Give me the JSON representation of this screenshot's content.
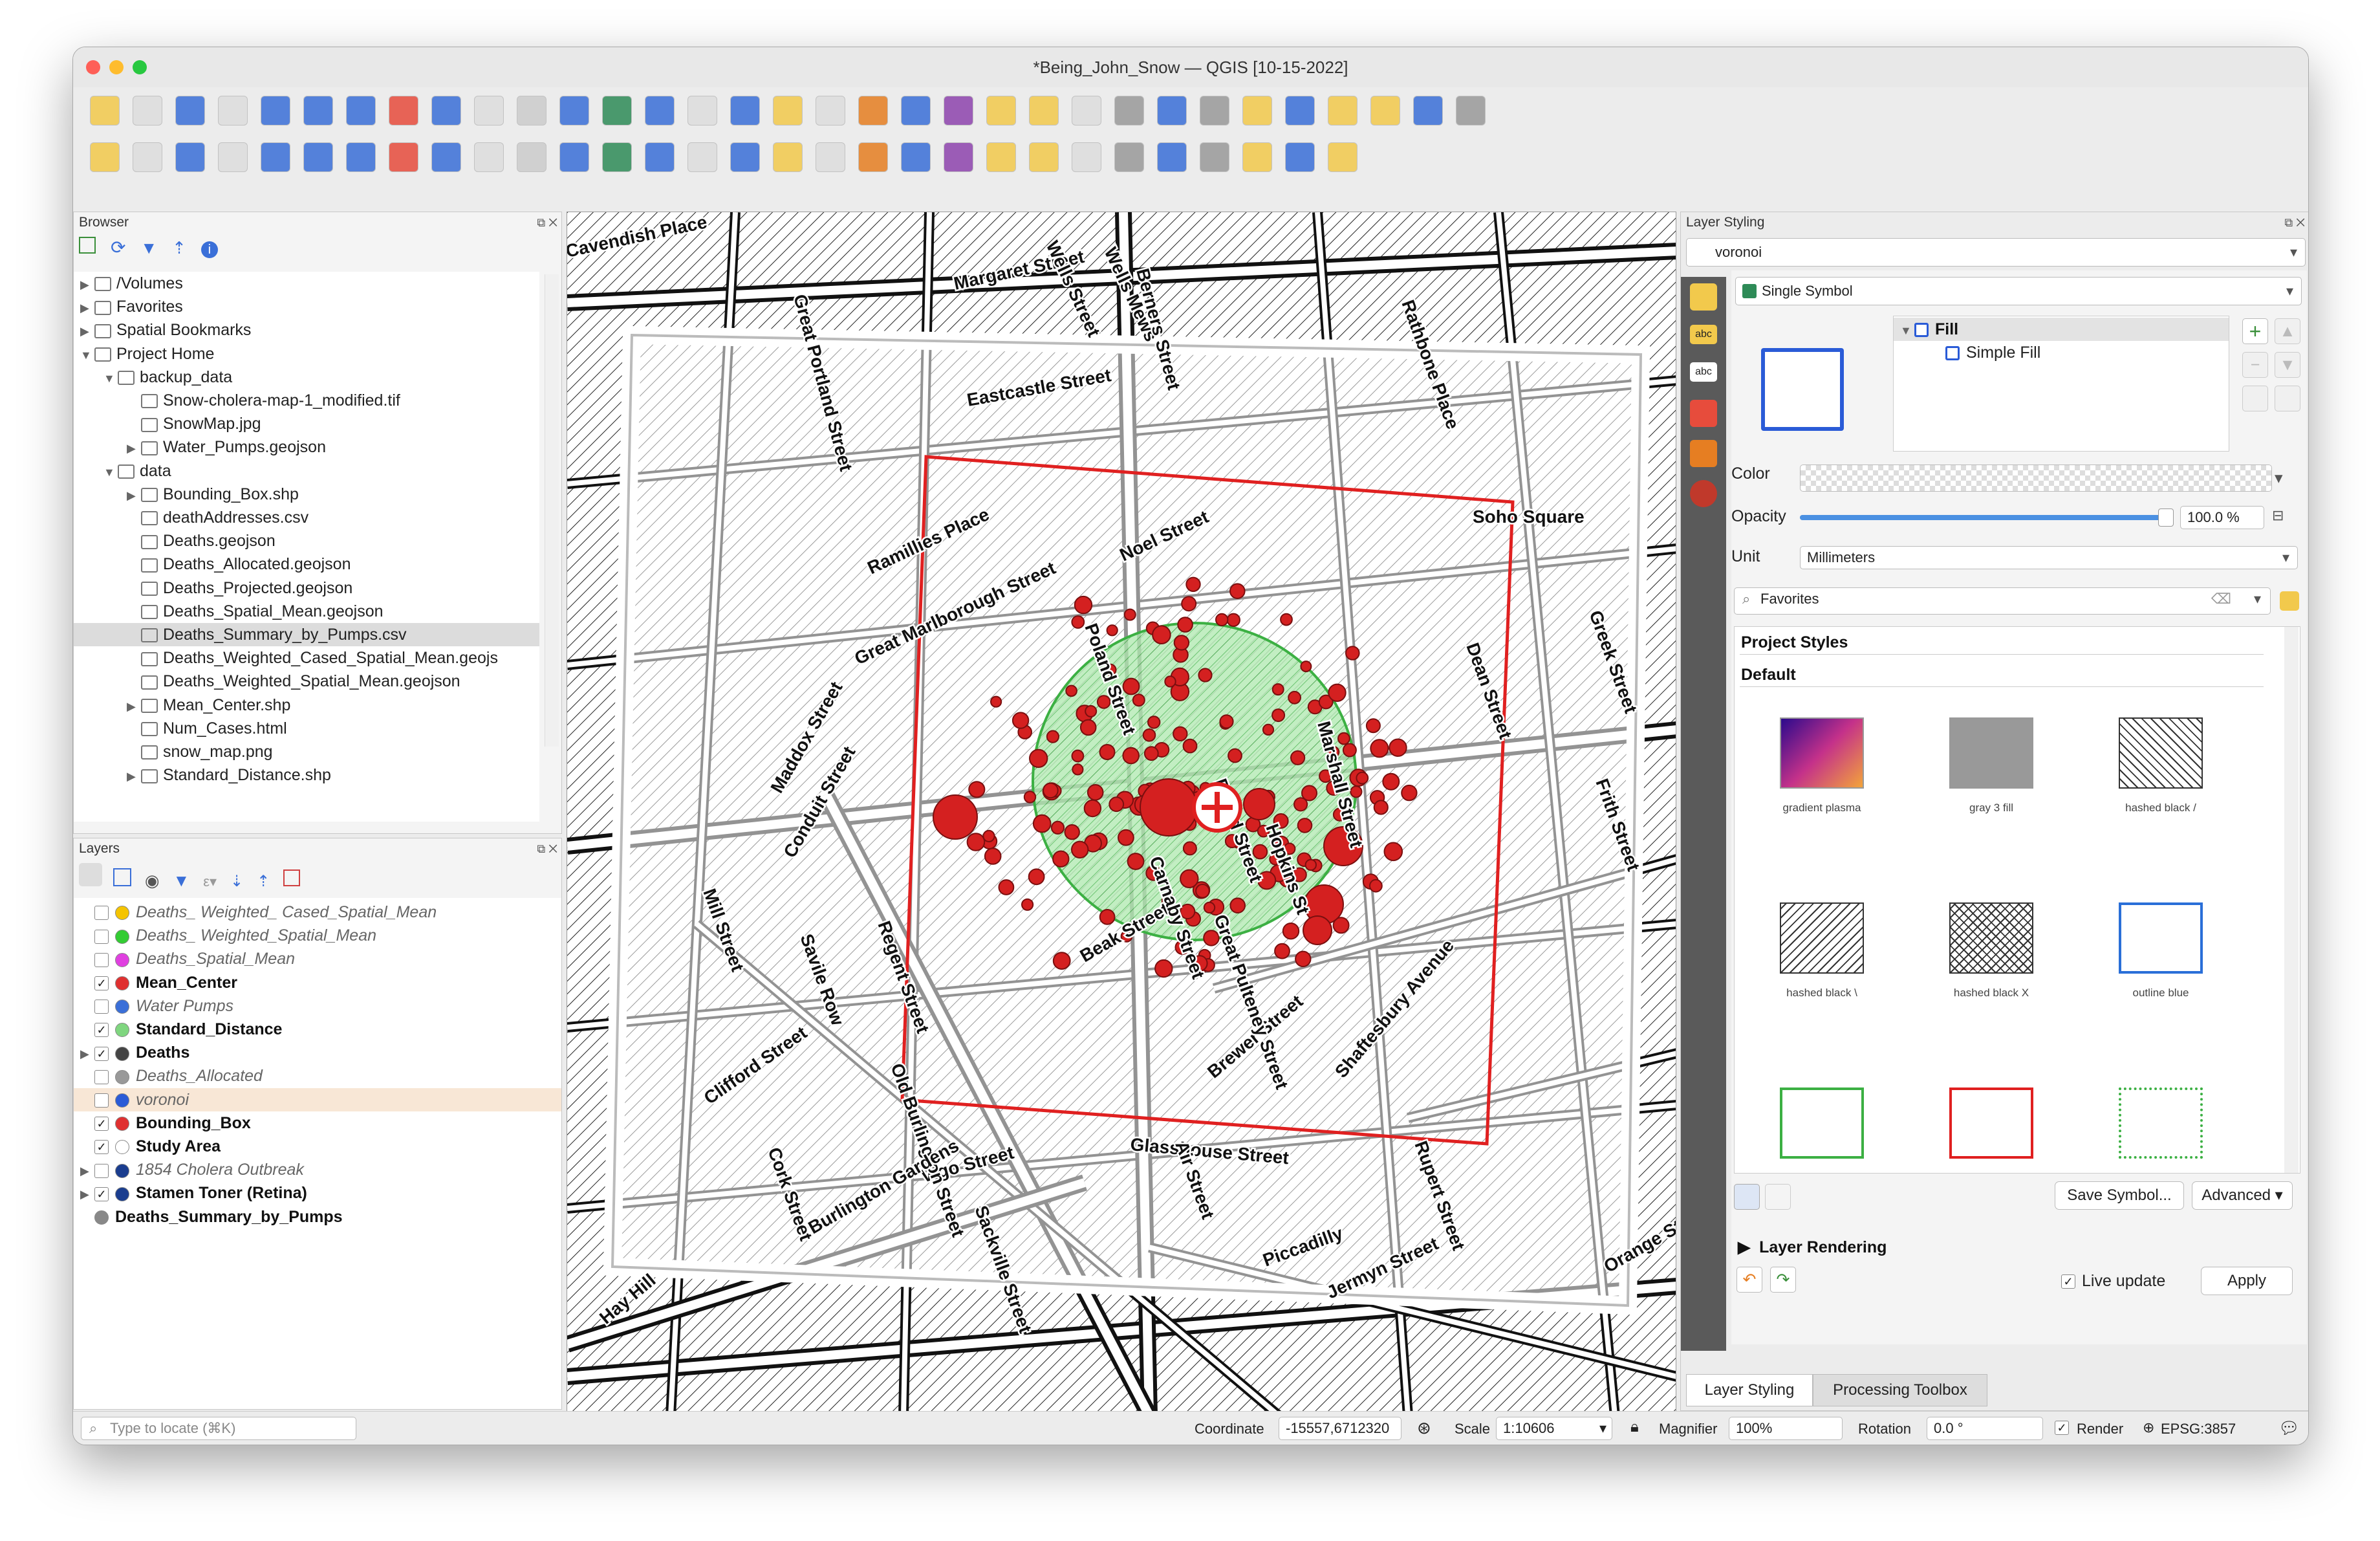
{
  "window": {
    "title": "*Being_John_Snow — QGIS [10-15-2022]"
  },
  "browser": {
    "title": "Browser",
    "items": [
      {
        "label": "/Volumes",
        "indent": 0,
        "arrow": "▶"
      },
      {
        "label": "Favorites",
        "indent": 0,
        "arrow": "▶"
      },
      {
        "label": "Spatial Bookmarks",
        "indent": 0,
        "arrow": "▶"
      },
      {
        "label": "Project Home",
        "indent": 0,
        "arrow": "▼"
      },
      {
        "label": "backup_data",
        "indent": 1,
        "arrow": "▼"
      },
      {
        "label": "Snow-cholera-map-1_modified.tif",
        "indent": 2,
        "arrow": ""
      },
      {
        "label": "SnowMap.jpg",
        "indent": 2,
        "arrow": ""
      },
      {
        "label": "Water_Pumps.geojson",
        "indent": 2,
        "arrow": "▶"
      },
      {
        "label": "data",
        "indent": 1,
        "arrow": "▼"
      },
      {
        "label": "Bounding_Box.shp",
        "indent": 2,
        "arrow": "▶"
      },
      {
        "label": "deathAddresses.csv",
        "indent": 2,
        "arrow": ""
      },
      {
        "label": "Deaths.geojson",
        "indent": 2,
        "arrow": ""
      },
      {
        "label": "Deaths_Allocated.geojson",
        "indent": 2,
        "arrow": ""
      },
      {
        "label": "Deaths_Projected.geojson",
        "indent": 2,
        "arrow": ""
      },
      {
        "label": "Deaths_Spatial_Mean.geojson",
        "indent": 2,
        "arrow": ""
      },
      {
        "label": "Deaths_Summary_by_Pumps.csv",
        "indent": 2,
        "arrow": "",
        "selected": true
      },
      {
        "label": "Deaths_Weighted_Cased_Spatial_Mean.geojs",
        "indent": 2,
        "arrow": ""
      },
      {
        "label": "Deaths_Weighted_Spatial_Mean.geojson",
        "indent": 2,
        "arrow": ""
      },
      {
        "label": "Mean_Center.shp",
        "indent": 2,
        "arrow": "▶"
      },
      {
        "label": "Num_Cases.html",
        "indent": 2,
        "arrow": ""
      },
      {
        "label": "snow_map.png",
        "indent": 2,
        "arrow": ""
      },
      {
        "label": "Standard_Distance.shp",
        "indent": 2,
        "arrow": "▶"
      }
    ]
  },
  "layers": {
    "title": "Layers",
    "items": [
      {
        "label": "Deaths_ Weighted_ Cased_Spatial_Mean",
        "checked": false,
        "style": "ital",
        "color": "#f5c400"
      },
      {
        "label": "Deaths_ Weighted_Spatial_Mean",
        "checked": false,
        "style": "ital",
        "color": "#33cc33"
      },
      {
        "label": "Deaths_Spatial_Mean",
        "checked": false,
        "style": "ital",
        "color": "#e040e0"
      },
      {
        "label": "Mean_Center",
        "checked": true,
        "style": "bold",
        "color": "#e03030"
      },
      {
        "label": "Water Pumps",
        "checked": false,
        "style": "ital",
        "color": "#3a6fd8"
      },
      {
        "label": "Standard_Distance",
        "checked": true,
        "style": "bold",
        "color": "#7fd67f"
      },
      {
        "label": "Deaths",
        "checked": true,
        "style": "bold",
        "color": "#444444"
      },
      {
        "label": "Deaths_Allocated",
        "checked": false,
        "style": "ital",
        "color": "#999999"
      },
      {
        "label": "voronoi",
        "checked": false,
        "style": "ital",
        "color": "#2a5bd7",
        "selected": true
      },
      {
        "label": "Bounding_Box",
        "checked": true,
        "style": "bold",
        "color": "#e03030"
      },
      {
        "label": "Study Area",
        "checked": true,
        "style": "bold",
        "color": "#ffffff"
      },
      {
        "label": "1854 Cholera Outbreak",
        "checked": false,
        "style": "ital",
        "color": "#1a3d8f"
      },
      {
        "label": "Stamen Toner (Retina)",
        "checked": true,
        "style": "bold",
        "color": "#1a3d8f"
      },
      {
        "label": "Deaths_Summary_by_Pumps",
        "checked": null,
        "style": "bold",
        "color": "#888888"
      }
    ]
  },
  "map": {
    "labels": [
      "Cavendish Place",
      "Great Portland Street",
      "Margaret Street",
      "Wells Street",
      "Wells Mews",
      "Berners Street",
      "Eastcastle Street",
      "Rathbone Place",
      "Soho Square",
      "Ramillies Place",
      "Noel Street",
      "Great Marlborough Street",
      "Poland Street",
      "Regent Street",
      "Maddox Street",
      "Conduit Street",
      "Mill Street",
      "Savile Row",
      "Beak Street",
      "Brewer Street",
      "Shaftesbury Avenue",
      "Glasshouse Street",
      "Vigo Street",
      "Piccadilly",
      "Old Burlington Street",
      "Clifford Street",
      "Cork Street",
      "Burlington Gardens",
      "Sackville Street",
      "Jermyn Street",
      "Rupert Street",
      "Dean Street",
      "Greek Street",
      "Frith Street",
      "Hay Hill",
      "Orange Street",
      "Air Street",
      "Broad Street",
      "Hopkins St",
      "Marshall Street",
      "Carnaby Street",
      "Great Pulteney Street"
    ]
  },
  "styling": {
    "title": "Layer Styling",
    "layer": "voronoi",
    "renderer": "Single Symbol",
    "tree": {
      "fill": "Fill",
      "simple_fill": "Simple Fill"
    },
    "color_label": "Color",
    "opacity_label": "Opacity",
    "opacity_value": "100.0 %",
    "opacity_fraction": 1.0,
    "unit_label": "Unit",
    "unit_value": "Millimeters",
    "search_placeholder": "Favorites",
    "project_styles": "Project Styles",
    "default_label": "Default",
    "styles": [
      {
        "name": "gradient  plasma"
      },
      {
        "name": "gray 3 fill"
      },
      {
        "name": "hashed black /"
      },
      {
        "name": "hashed black \\"
      },
      {
        "name": "hashed black X"
      },
      {
        "name": "outline blue"
      },
      {
        "name": ""
      },
      {
        "name": ""
      },
      {
        "name": ""
      }
    ],
    "save_symbol": "Save Symbol...",
    "advanced": "Advanced",
    "layer_rendering": "Layer Rendering",
    "live_update": "Live update",
    "apply": "Apply",
    "tab_styling": "Layer Styling",
    "tab_processing": "Processing Toolbox"
  },
  "status": {
    "locate_placeholder": "Type to locate (⌘K)",
    "coordinate_label": "Coordinate",
    "coordinate_value": "-15557,6712320",
    "scale_label": "Scale",
    "scale_value": "1:10606",
    "magnifier_label": "Magnifier",
    "magnifier_value": "100%",
    "rotation_label": "Rotation",
    "rotation_value": "0.0 °",
    "render_label": "Render",
    "crs": "EPSG:3857"
  }
}
